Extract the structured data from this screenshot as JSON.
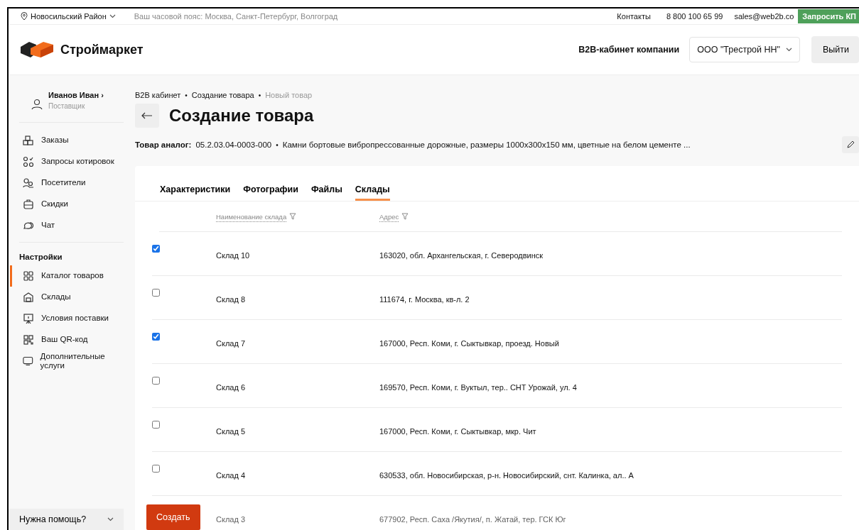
{
  "top_bar": {
    "region": "Новосильский Район",
    "timezone": "Ваш часовой пояс: Москва, Санкт-Петербург, Волгоград",
    "contacts": "Контакты",
    "phone": "8 800 100 65 99",
    "email": "sales@web2b.co",
    "request_button": "Запросить КП"
  },
  "header": {
    "logo": "Строймаркет",
    "cabinet_label": "B2B-кабинет компании",
    "company_select": "ООО \"Трестрой НН\"",
    "logout_button": "Выйти"
  },
  "sidebar": {
    "user": {
      "name": "Иванов Иван",
      "chevron": "›",
      "role": "Поставщик"
    },
    "items": [
      {
        "label": "Заказы",
        "selected": false
      },
      {
        "label": "Запросы котировок",
        "selected": false
      },
      {
        "label": "Посетители",
        "selected": false
      },
      {
        "label": "Скидки",
        "selected": false
      },
      {
        "label": "Чат",
        "selected": false
      }
    ],
    "settings_title": "Настройки",
    "settings_items": [
      {
        "label": "Каталог товаров",
        "selected": true
      },
      {
        "label": "Склады",
        "selected": false
      },
      {
        "label": "Условия поставки",
        "selected": false
      },
      {
        "label": "Ваш QR-код",
        "selected": false
      },
      {
        "label": "Дополнительные услуги",
        "selected": false
      }
    ],
    "help": "Нужна помощь?"
  },
  "breadcrumb_separator": "•",
  "breadcrumbs": [
    {
      "label": "B2B кабинет",
      "current": false
    },
    {
      "label": "Создание товара",
      "current": false
    },
    {
      "label": "Новый товар",
      "current": true
    }
  ],
  "page_title": "Создание товара",
  "analog": {
    "label": "Товар аналог:",
    "code": "05.2.03.04-0003-000",
    "separator": "•",
    "name": "Камни бортовые вибропрессованные дорожные, размеры 1000х300х150 мм, цветные на белом цементе ..."
  },
  "tabs": [
    {
      "label": "Характеристики",
      "selected": false
    },
    {
      "label": "Фотографии",
      "selected": false
    },
    {
      "label": "Файлы",
      "selected": false
    },
    {
      "label": "Склады",
      "selected": true
    }
  ],
  "table": {
    "columns": [
      "Наименование склада",
      "Адрес"
    ],
    "rows": [
      {
        "checked": true,
        "name": "Склад 10",
        "address": "163020, обл. Архангельская, г. Северодвинск"
      },
      {
        "checked": false,
        "name": "Склад 8",
        "address": "111674, г. Москва, кв-л. 2"
      },
      {
        "checked": true,
        "name": "Склад 7",
        "address": "167000, Респ. Коми, г. Сыктывкар, проезд. Новый"
      },
      {
        "checked": false,
        "name": "Склад 6",
        "address": "169570, Респ. Коми, г. Вуктыл, тер.. СНТ Урожай, ул. 4"
      },
      {
        "checked": false,
        "name": "Склад 5",
        "address": "167000, Респ. Коми, г. Сыктывкар, мкр. Чит"
      },
      {
        "checked": false,
        "name": "Склад 4",
        "address": "630533, обл. Новосибирская, р-н. Новосибирский, снт. Калинка, ал.. А"
      },
      {
        "name": "Склад 3",
        "address": "677902, Респ. Саха /Якутия/, п. Жатай, тер. ГСК Юг"
      }
    ]
  },
  "create_button": "Создать"
}
